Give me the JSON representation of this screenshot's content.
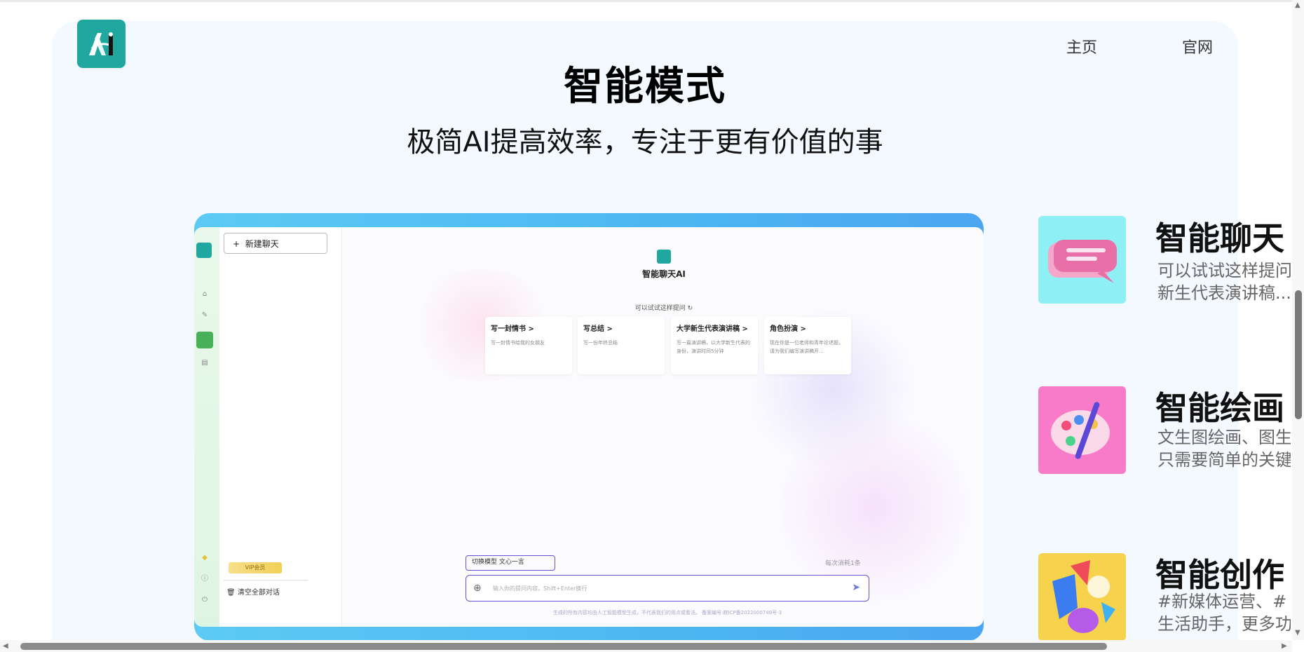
{
  "nav": {
    "home": "主页",
    "official": "官网"
  },
  "hero": {
    "title": "智能模式",
    "subtitle": "极简AI提高效率，专注于更有价值的事"
  },
  "mockup": {
    "new_chat": "新建聊天",
    "app_title": "智能聊天AI",
    "try_prompt": "可以试试这样提问 ↻",
    "cards": [
      {
        "title": "写一封情书 >",
        "desc": "写一封情书给我的女朋友"
      },
      {
        "title": "写总结 >",
        "desc": "写一份年终总结"
      },
      {
        "title": "大学新生代表演讲稿 >",
        "desc": "写一篇演讲稿，以大学新生代表的身份，演讲时间5分钟"
      },
      {
        "title": "角色扮演 >",
        "desc": "现在你是一位老师和青年论述题，请为我们编写演讲稿开..."
      }
    ],
    "vip": "VIP会员",
    "clear_all": "清空全部对话",
    "model_switch": "切换模型 文心一言",
    "consume": "每次消耗1条",
    "input_placeholder": "输入你的提问内容，Shift+Enter换行",
    "footer_note": "生成的所有内容均由人工智能模型生成，不代表我们的观点或看法。  备案编号:皖ICP备2022000749号-3"
  },
  "features": [
    {
      "title": "智能聊天",
      "line1": "可以试试这样提问",
      "line2": "新生代表演讲稿..."
    },
    {
      "title": "智能绘画",
      "line1": "文生图绘画、图生图",
      "line2": "只需要简单的关键词"
    },
    {
      "title": "智能创作",
      "line1": "#新媒体运营、#",
      "line2": "生活助手，更多功能"
    }
  ],
  "icons": [
    "logo-icon",
    "home-icon",
    "chat-icon",
    "pen-icon",
    "doc-icon",
    "diamond-icon",
    "info-icon",
    "power-icon",
    "trash-icon",
    "plus-icon",
    "send-icon"
  ]
}
